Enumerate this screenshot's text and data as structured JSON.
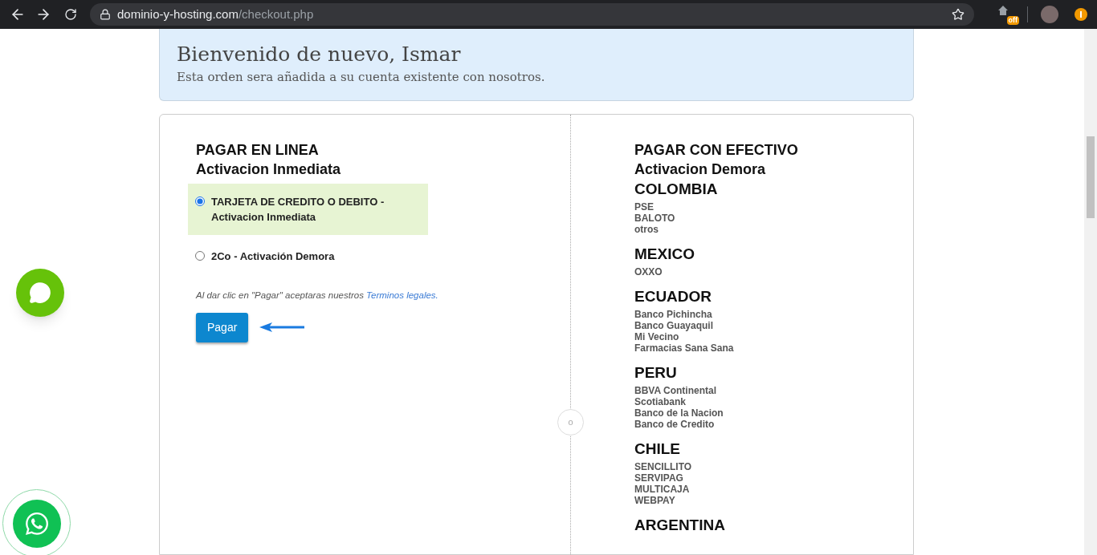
{
  "browser": {
    "url_domain": "dominio-y-hosting.com",
    "url_path": "/checkout.php",
    "extension_badge": "off"
  },
  "welcome": {
    "title": "Bienvenido de nuevo, Ismar",
    "subtitle": "Esta orden sera añadida a su cuenta existente con nosotros."
  },
  "online": {
    "title": "PAGAR EN LINEA",
    "subtitle": "Activacion Inmediata",
    "options": [
      {
        "label": "TARJETA DE CREDITO O DEBITO - Activacion Inmediata",
        "selected": true
      },
      {
        "label": "2Co - Activación Demora",
        "selected": false
      }
    ],
    "terms_text": "Al dar clic en \"Pagar\" aceptaras nuestros",
    "terms_link": "Terminos legales.",
    "pay_button": "Pagar"
  },
  "divider_label": "o",
  "cash": {
    "title": "PAGAR CON EFECTIVO",
    "subtitle": "Activacion Demora",
    "countries": [
      {
        "name": "COLOMBIA",
        "methods": [
          "PSE",
          "BALOTO",
          "otros"
        ]
      },
      {
        "name": "MEXICO",
        "methods": [
          "OXXO"
        ]
      },
      {
        "name": "ECUADOR",
        "methods": [
          "Banco Pichincha",
          "Banco Guayaquil",
          "Mi Vecino",
          "Farmacias Sana Sana"
        ]
      },
      {
        "name": "PERU",
        "methods": [
          "BBVA Continental",
          "Scotiabank",
          "Banco de la Nacion",
          "Banco de Credito"
        ]
      },
      {
        "name": "CHILE",
        "methods": [
          "SENCILLITO",
          "SERVIPAG",
          "MULTICAJA",
          "WEBPAY"
        ]
      },
      {
        "name": "ARGENTINA"
      }
    ]
  }
}
